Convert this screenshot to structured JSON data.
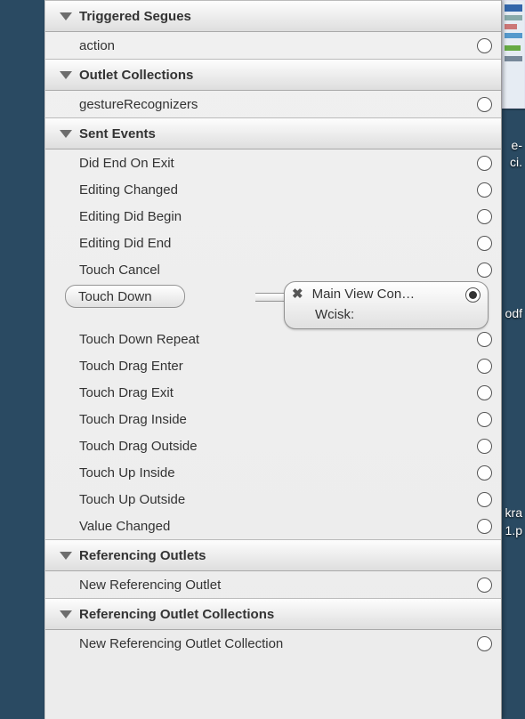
{
  "sections": [
    {
      "title": "Triggered Segues",
      "rows": [
        {
          "label": "action",
          "connected": false
        }
      ]
    },
    {
      "title": "Outlet Collections",
      "rows": [
        {
          "label": "gestureRecognizers",
          "connected": false
        }
      ]
    },
    {
      "title": "Sent Events",
      "rows": [
        {
          "label": "Did End On Exit",
          "connected": false
        },
        {
          "label": "Editing Changed",
          "connected": false
        },
        {
          "label": "Editing Did Begin",
          "connected": false
        },
        {
          "label": "Editing Did End",
          "connected": false
        },
        {
          "label": "Touch Cancel",
          "connected": false
        },
        {
          "label": "Touch Down",
          "connected": true,
          "connection": {
            "destination": "Main View Con…",
            "action": "Wcisk:"
          }
        },
        {
          "label": "Touch Down Repeat",
          "connected": false
        },
        {
          "label": "Touch Drag Enter",
          "connected": false
        },
        {
          "label": "Touch Drag Exit",
          "connected": false
        },
        {
          "label": "Touch Drag Inside",
          "connected": false
        },
        {
          "label": "Touch Drag Outside",
          "connected": false
        },
        {
          "label": "Touch Up Inside",
          "connected": false
        },
        {
          "label": "Touch Up Outside",
          "connected": false
        },
        {
          "label": "Value Changed",
          "connected": false
        }
      ]
    },
    {
      "title": "Referencing Outlets",
      "rows": [
        {
          "label": "New Referencing Outlet",
          "connected": false
        }
      ]
    },
    {
      "title": "Referencing Outlet Collections",
      "rows": [
        {
          "label": "New Referencing Outlet Collection",
          "connected": false
        }
      ]
    }
  ],
  "desktop": {
    "captions": [
      "e-",
      "ci.",
      "odf",
      "kra",
      "1.p"
    ]
  }
}
